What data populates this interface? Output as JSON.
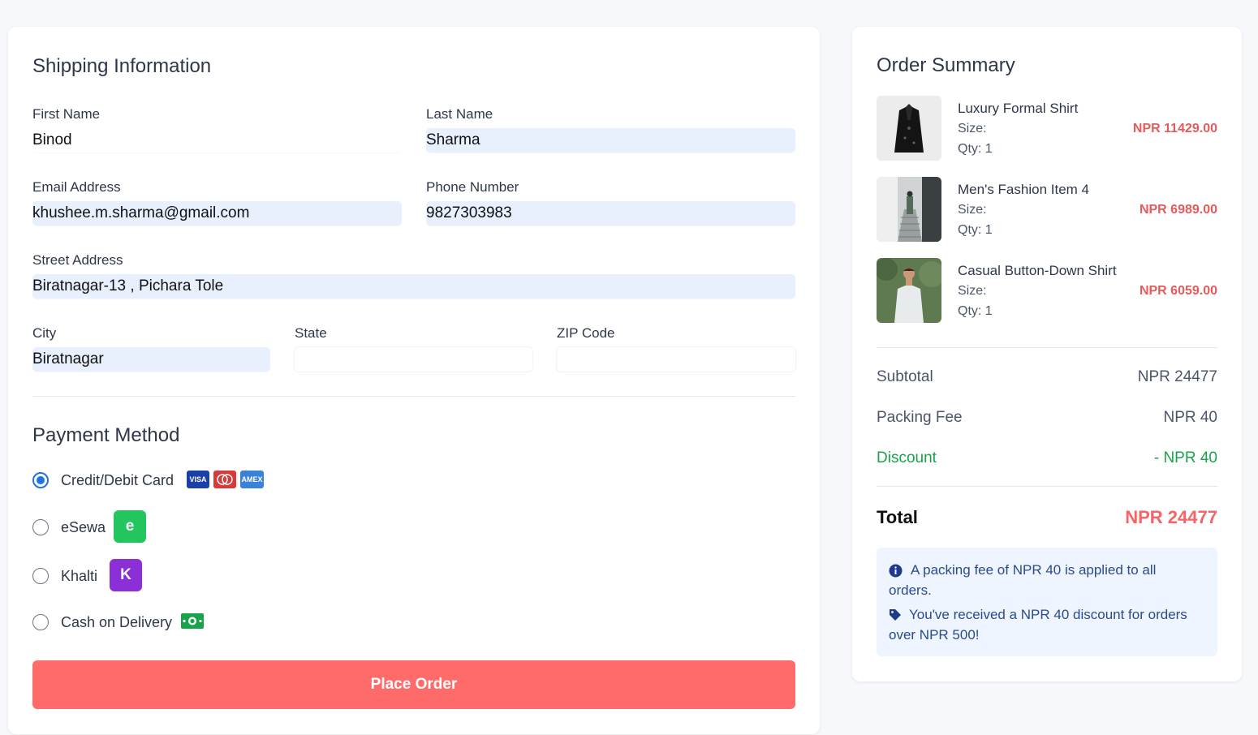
{
  "shipping": {
    "title": "Shipping Information",
    "first_name": {
      "label": "First Name",
      "value": "Binod"
    },
    "last_name": {
      "label": "Last Name",
      "value": "Sharma"
    },
    "email": {
      "label": "Email Address",
      "value": "khushee.m.sharma@gmail.com"
    },
    "phone": {
      "label": "Phone Number",
      "value": "9827303983"
    },
    "street": {
      "label": "Street Address",
      "value": "Biratnagar-13 , Pichara Tole"
    },
    "city": {
      "label": "City",
      "value": "Biratnagar"
    },
    "state": {
      "label": "State",
      "value": ""
    },
    "zip": {
      "label": "ZIP Code",
      "value": ""
    }
  },
  "payment": {
    "title": "Payment Method",
    "options": [
      {
        "label": "Credit/Debit Card",
        "checked": true,
        "icons": [
          "VISA",
          "MC",
          "AMEX"
        ]
      },
      {
        "label": "eSewa",
        "checked": false,
        "badge": "e"
      },
      {
        "label": "Khalti",
        "checked": false,
        "badge": "K"
      },
      {
        "label": "Cash on Delivery",
        "checked": false,
        "icon": "cash-icon"
      }
    ],
    "submit_label": "Place Order"
  },
  "summary": {
    "title": "Order Summary",
    "items": [
      {
        "name": "Luxury Formal Shirt",
        "size": "Size:",
        "qty": "Qty: 1",
        "price": "NPR 11429.00"
      },
      {
        "name": "Men's Fashion Item 4",
        "size": "Size:",
        "qty": "Qty: 1",
        "price": "NPR 6989.00"
      },
      {
        "name": "Casual Button-Down Shirt",
        "size": "Size:",
        "qty": "Qty: 1",
        "price": "NPR 6059.00"
      }
    ],
    "subtotal_label": "Subtotal",
    "subtotal": "NPR 24477",
    "packing_label": "Packing Fee",
    "packing": "NPR 40",
    "discount_label": "Discount",
    "discount": "- NPR 40",
    "total_label": "Total",
    "total": "NPR 24477",
    "info_1a": "A packing fee of NPR 40 is applied to all",
    "info_1b": "orders.",
    "info_2a": "You've received a NPR 40 discount for orders",
    "info_2b": "over NPR 500!"
  },
  "colors": {
    "accent": "#ff6b6b",
    "price": "#e55b5b",
    "discount": "#16a34a",
    "radio": "#1a73e8",
    "esewa": "#22c55e",
    "khalti": "#8b2fd6"
  }
}
